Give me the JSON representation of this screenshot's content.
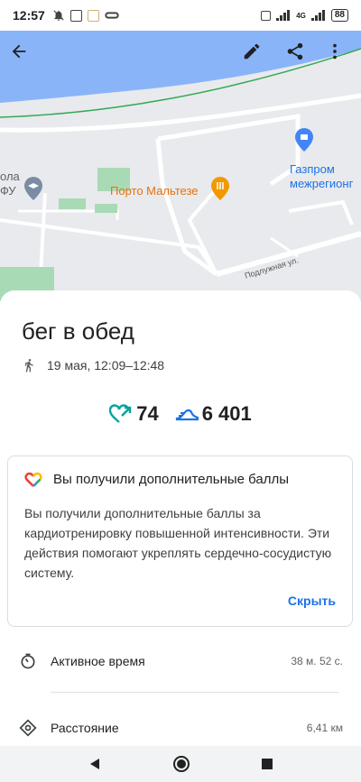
{
  "status": {
    "time": "12:57",
    "network": "4G",
    "battery": "88"
  },
  "map": {
    "poi_cafe": "Порто Мальтезе",
    "poi_company": "Газпром\nмежрегионг",
    "poi_school": "ола\nФУ",
    "street": "Подлужная ул."
  },
  "activity": {
    "title": "бег в обед",
    "datetime": "19 мая, 12:09–12:48",
    "heart_points": "74",
    "steps": "6 401"
  },
  "card": {
    "title": "Вы получили дополнительные баллы",
    "body": "Вы получили дополнительные баллы за кардиотренировку повышенной интенсивности. Эти действия помогают укреплять сердечно-сосудистую систему.",
    "dismiss": "Скрыть"
  },
  "details": [
    {
      "label": "Активное время",
      "value": "38 м. 52 с.",
      "icon": "timer-icon"
    },
    {
      "label": "Расстояние",
      "value": "6,41 км",
      "icon": "location-icon"
    }
  ],
  "colors": {
    "water": "#8ab4f8",
    "accent": "#1a73e8",
    "heart": "#00a2a1",
    "steps": "#1a73e8"
  }
}
